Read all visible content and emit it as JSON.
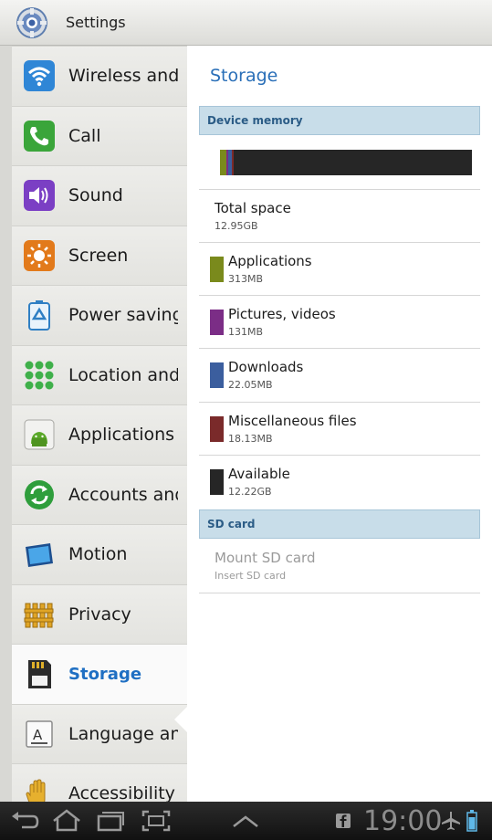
{
  "app": {
    "title": "Settings",
    "icon": "settings-gear-icon"
  },
  "sidebar": {
    "items": [
      {
        "label": "Wireless and",
        "icon": "wifi-icon"
      },
      {
        "label": "Call",
        "icon": "phone-icon"
      },
      {
        "label": "Sound",
        "icon": "speaker-icon"
      },
      {
        "label": "Screen",
        "icon": "brightness-icon"
      },
      {
        "label": "Power saving",
        "icon": "recycle-battery-icon"
      },
      {
        "label": "Location and",
        "icon": "location-grid-icon"
      },
      {
        "label": "Applications",
        "icon": "android-icon"
      },
      {
        "label": "Accounts and",
        "icon": "sync-icon"
      },
      {
        "label": "Motion",
        "icon": "motion-tablet-icon"
      },
      {
        "label": "Privacy",
        "icon": "fence-icon"
      },
      {
        "label": "Storage",
        "icon": "sd-card-icon",
        "selected": true
      },
      {
        "label": "Language an",
        "icon": "language-icon"
      },
      {
        "label": "Accessibility",
        "icon": "hand-icon"
      }
    ]
  },
  "main": {
    "title": "Storage",
    "device_memory": {
      "header": "Device memory",
      "usage_bar": {
        "segments": [
          {
            "name": "Applications",
            "color": "#7a8a1c",
            "fraction": 0.024
          },
          {
            "name": "Pictures, videos",
            "color": "#7b2d86",
            "fraction": 0.01
          },
          {
            "name": "Downloads",
            "color": "#3b5e9e",
            "fraction": 0.012
          },
          {
            "name": "Miscellaneous files",
            "color": "#7a2a2a",
            "fraction": 0.01
          },
          {
            "name": "Available",
            "color": "#262626",
            "fraction": 0.944
          }
        ]
      },
      "total": {
        "label": "Total space",
        "value": "12.95GB"
      },
      "items": [
        {
          "label": "Applications",
          "value": "313MB",
          "color": "#7a8a1c"
        },
        {
          "label": "Pictures, videos",
          "value": "131MB",
          "color": "#7b2d86"
        },
        {
          "label": "Downloads",
          "value": "22.05MB",
          "color": "#3b5e9e"
        },
        {
          "label": "Miscellaneous files",
          "value": "18.13MB",
          "color": "#7a2a2a"
        },
        {
          "label": "Available",
          "value": "12.22GB",
          "color": "#262626"
        }
      ]
    },
    "sd_card": {
      "header": "SD card",
      "mount": {
        "label": "Mount SD card",
        "sub": "Insert SD card"
      }
    }
  },
  "system_bar": {
    "clock": "19:00",
    "icons": [
      "back-icon",
      "home-icon",
      "recent-apps-icon",
      "screenshot-icon",
      "up-chevron-icon",
      "facebook-icon",
      "airplane-icon",
      "battery-icon"
    ]
  }
}
